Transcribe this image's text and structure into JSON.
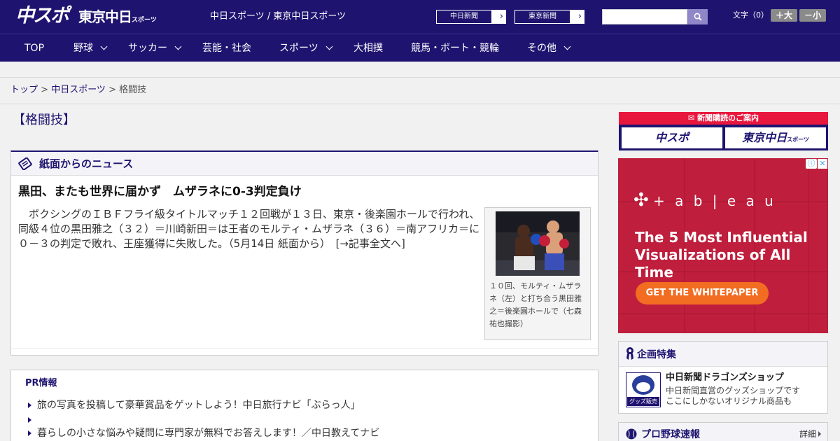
{
  "header": {
    "logo_chuspo": "中スポ",
    "logo_tokyo": "東京中日",
    "logo_tokyo_small": "スポーツ",
    "tagline": "中日スポーツ / 東京中日スポーツ",
    "chunichi_btn": "中日新聞",
    "tokyo_btn": "東京新聞",
    "search_placeholder": "",
    "font_size_label": "文字（0）",
    "font_larger": "＋大",
    "font_smaller": "－小"
  },
  "nav": {
    "items": [
      "TOP",
      "野球",
      "サッカー",
      "芸能・社会",
      "スポーツ",
      "大相撲",
      "競馬・ボート・競輪",
      "その他"
    ]
  },
  "breadcrumb": {
    "top": "トップ",
    "sep1": " > ",
    "parent": "中日スポーツ",
    "sep2": " > ",
    "current": "格闘技"
  },
  "page": {
    "section_title": "【格闘技】"
  },
  "news": {
    "header": "紙面からのニュース",
    "headline": "黒田、またも世界に届かず　ムザラネに0-3判定負け",
    "body": "ボクシングのＩＢＦフライ級タイトルマッチ１２回戦が１３日、東京・後楽園ホールで行われ、同級４位の黒田雅之（３２）＝川崎新田＝は王者のモルティ・ムザラネ（３６）＝南アフリカ＝に０－３の判定で敗れ、王座獲得に失敗した。（5月14日 紙面から）　",
    "more_link": "[→記事全文へ]",
    "caption": "１０回、モルティ・ムザラネ（左）と打ち合う黒田雅之＝後楽園ホールで（七森祐也撮影）"
  },
  "pr": {
    "title": "PR情報",
    "items": [
      "旅の写真を投稿して豪華賞品をゲットしよう！中日旅行ナビ「ぶらっ人」",
      "",
      "暮らしの小さな悩みや疑問に専門家が無料でお答えします！／中日教えてナビ"
    ]
  },
  "sidebar": {
    "subscribe_head": "新聞購読のご案内",
    "sub_logo_chuspo": "中スポ",
    "sub_logo_tokyo": "東京中日",
    "sub_logo_tokyo_small": "スポーツ",
    "ad": {
      "brand": "+ a b | e a u",
      "brand_mark": "✣",
      "headline": "The 5 Most Influential Visualizations of All Time",
      "cta": "GET THE WHITEPAPER",
      "info": "ⓘ",
      "close": "✕"
    },
    "kikaku": {
      "title": "企画特集",
      "shop_name": "中日新聞ドラゴンズショップ",
      "shop_desc_1": "中日新聞直営のグッズショップです",
      "shop_desc_2": "ここにしかないオリジナル商品も",
      "thumb_tag": "グッズ販売中"
    },
    "yakyu": {
      "title": "プロ野球速報",
      "more": "詳細"
    }
  },
  "colors": {
    "brand_navy": "#1e1470",
    "ad_red": "#bf1e3c",
    "cta_orange": "#f26c21",
    "subscribe_red": "#e8173d"
  }
}
